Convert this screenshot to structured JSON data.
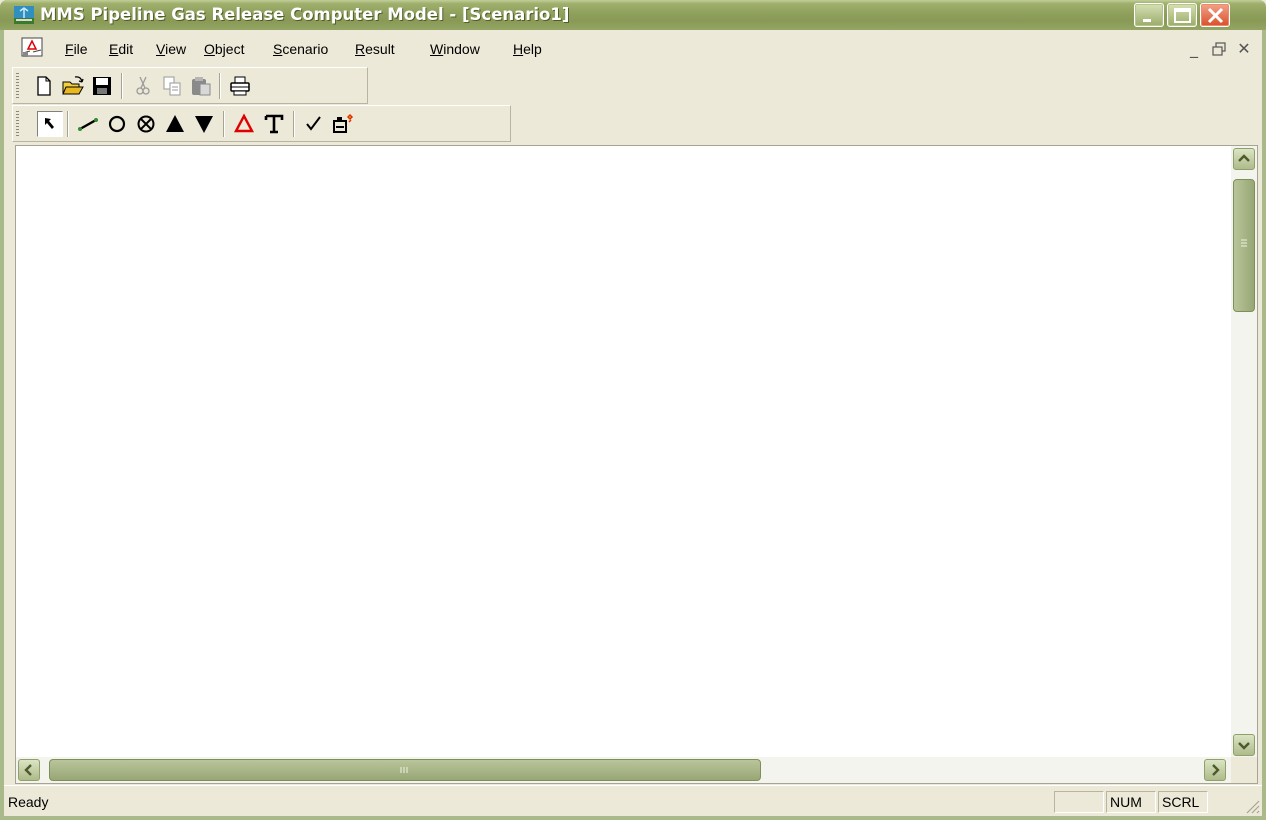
{
  "window": {
    "title": "MMS Pipeline Gas Release Computer Model - [Scenario1]",
    "controls": [
      "minimize-icon",
      "maximize-icon",
      "close-icon"
    ]
  },
  "menubar": {
    "items": [
      {
        "label": "File",
        "accel": "F",
        "rest": "ile"
      },
      {
        "label": "Edit",
        "accel": "E",
        "rest": "dit"
      },
      {
        "label": "View",
        "accel": "V",
        "rest": "iew"
      },
      {
        "label": "Object",
        "accel": "O",
        "rest": "bject"
      },
      {
        "label": "Scenario",
        "accel": "S",
        "rest": "cenario"
      },
      {
        "label": "Result",
        "accel": "R",
        "rest": "esult"
      },
      {
        "label": "Window",
        "accel": "W",
        "rest": "indow"
      },
      {
        "label": "Help",
        "accel": "H",
        "rest": "elp"
      }
    ],
    "mdi_controls": {
      "minimize": "_",
      "restore": "🗗",
      "close": "✕"
    }
  },
  "toolbar_standard": {
    "buttons": [
      "new-icon",
      "open-icon",
      "save-icon",
      "cut-icon",
      "copy-icon",
      "paste-icon",
      "print-icon"
    ]
  },
  "toolbar_objects": {
    "buttons": [
      "select-arrow-icon",
      "pipe-segment-icon",
      "node-circle-icon",
      "valve-icon",
      "source-triangle-icon",
      "sink-triangle-icon",
      "release-point-icon",
      "text-icon",
      "check-icon",
      "compute-icon"
    ],
    "glyphs": {
      "node": "O",
      "valve": "⊗",
      "source": "▲",
      "sink": "▼",
      "release": "Δ",
      "text": "T",
      "check": "✓"
    },
    "colors": {
      "release": "#e00000",
      "pipe": "#2e8b2e"
    }
  },
  "statusbar": {
    "message": "Ready",
    "indicators": [
      "",
      "NUM",
      "SCRL"
    ]
  },
  "colors": {
    "titlebar": "#8ea05c",
    "chrome": "#ece9d8",
    "scroll_thumb": "#a7b584"
  }
}
